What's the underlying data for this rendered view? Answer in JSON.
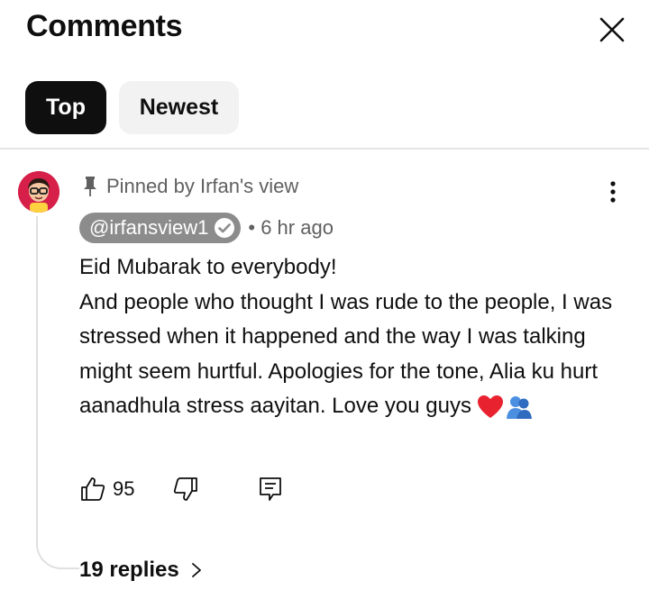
{
  "header": {
    "title": "Comments",
    "close_icon": "close-icon"
  },
  "filters": {
    "tabs": [
      {
        "label": "Top",
        "selected": true
      },
      {
        "label": "Newest",
        "selected": false
      }
    ]
  },
  "comment": {
    "avatar_icon": "channel-avatar",
    "pinned_icon": "pin-icon",
    "pinned_text": "Pinned by Irfan's view",
    "author": "@irfansview1",
    "verified_icon": "verified-check-icon",
    "time": "• 6 hr ago",
    "text": "Eid Mubarak to everybody!\nAnd people who thought I was rude to the people, I was stressed when it happened and the way I was talking might seem hurtful. Apologies for the tone, Alia ku hurt aanadhula stress aayitan. Love you guys",
    "emojis": [
      "heart-emoji",
      "people-hugging-emoji"
    ],
    "likes": "95",
    "actions": [
      "like-icon",
      "dislike-icon",
      "reply-icon"
    ],
    "more_icon": "more-vertical-icon",
    "replies_label": "19 replies",
    "replies_icon": "chevron-right-icon"
  },
  "colors": {
    "selected_chip": "#0f0f0f",
    "unselected_chip": "#f2f2f2",
    "handle_chip": "#8c8c8c",
    "secondary_text": "#606060",
    "avatar_bg": "#d6204a"
  }
}
